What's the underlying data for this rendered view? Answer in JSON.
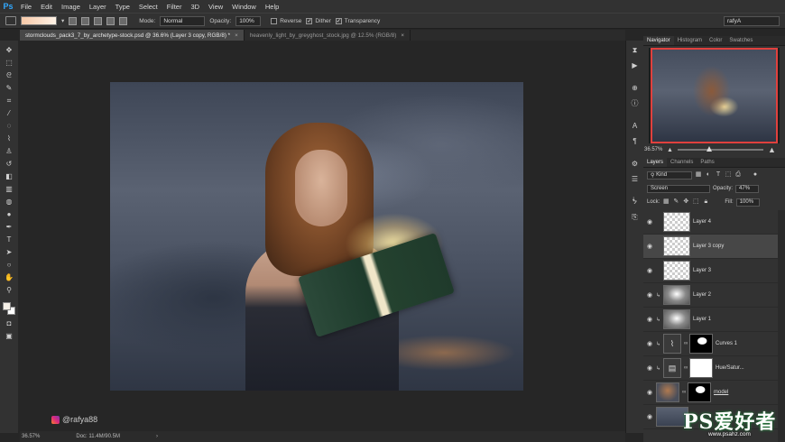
{
  "app": {
    "logo": "Ps",
    "menu": [
      "File",
      "Edit",
      "Image",
      "Layer",
      "Type",
      "Select",
      "Filter",
      "3D",
      "View",
      "Window",
      "Help"
    ]
  },
  "options_bar": {
    "mode_label": "Mode:",
    "mode_value": "Normal",
    "opacity_label": "Opacity:",
    "opacity_value": "100%",
    "reverse_label": "Reverse",
    "reverse_checked": false,
    "dither_label": "Dither",
    "dither_checked": true,
    "transparency_label": "Transparency",
    "transparency_checked": true,
    "workspace": "rafyA"
  },
  "tabs": [
    {
      "label": "stormclouds_pack3_7_by_archetype-stock.psd @ 36.6% (Layer 3 copy, RGB/8) *",
      "active": true
    },
    {
      "label": "heavenly_light_by_greyghost_stock.jpg @ 12.5% (RGB/8)",
      "active": false
    }
  ],
  "signature": "@rafya88",
  "status": {
    "zoom": "36.57%",
    "doc": "Doc: 11.4M/90.5M"
  },
  "navigator": {
    "tabs": [
      "Navigator",
      "Histogram",
      "Color",
      "Swatches"
    ],
    "zoom": "36.57%",
    "slider_position": 0.34
  },
  "layers_panel": {
    "tabs": [
      "Layers",
      "Channels",
      "Paths"
    ],
    "kind_label": "Kind",
    "blend_mode": "Screen",
    "opacity_label": "Opacity:",
    "opacity_value": "47%",
    "lock_label": "Lock:",
    "fill_label": "Fill:",
    "fill_value": "100%",
    "layers": [
      {
        "name": "Layer 4",
        "thumb": "transparent",
        "selected": false,
        "clipped": false,
        "mask": null
      },
      {
        "name": "Layer 3 copy",
        "thumb": "transparent",
        "selected": true,
        "clipped": false,
        "mask": null
      },
      {
        "name": "Layer 3",
        "thumb": "transparent",
        "selected": false,
        "clipped": false,
        "mask": null
      },
      {
        "name": "Layer 2",
        "thumb": "bw",
        "selected": false,
        "clipped": true,
        "mask": null
      },
      {
        "name": "Layer 1",
        "thumb": "bw",
        "selected": false,
        "clipped": true,
        "mask": null
      },
      {
        "name": "Curves 1",
        "thumb": "adj",
        "selected": false,
        "clipped": true,
        "mask": "black"
      },
      {
        "name": "Hue/Satur...",
        "thumb": "adj",
        "selected": false,
        "clipped": true,
        "mask": "white"
      },
      {
        "name": "model",
        "thumb": "photo",
        "selected": false,
        "clipped": false,
        "mask": "black"
      },
      {
        "name": "",
        "thumb": "sky",
        "selected": false,
        "clipped": false,
        "mask": null
      }
    ]
  },
  "watermark": {
    "big": "PS爱好者",
    "url": "www.psahz.com"
  },
  "colors": {
    "accent_red": "#e0403d",
    "panel_bg": "#323232",
    "canvas_bg": "#262626"
  }
}
